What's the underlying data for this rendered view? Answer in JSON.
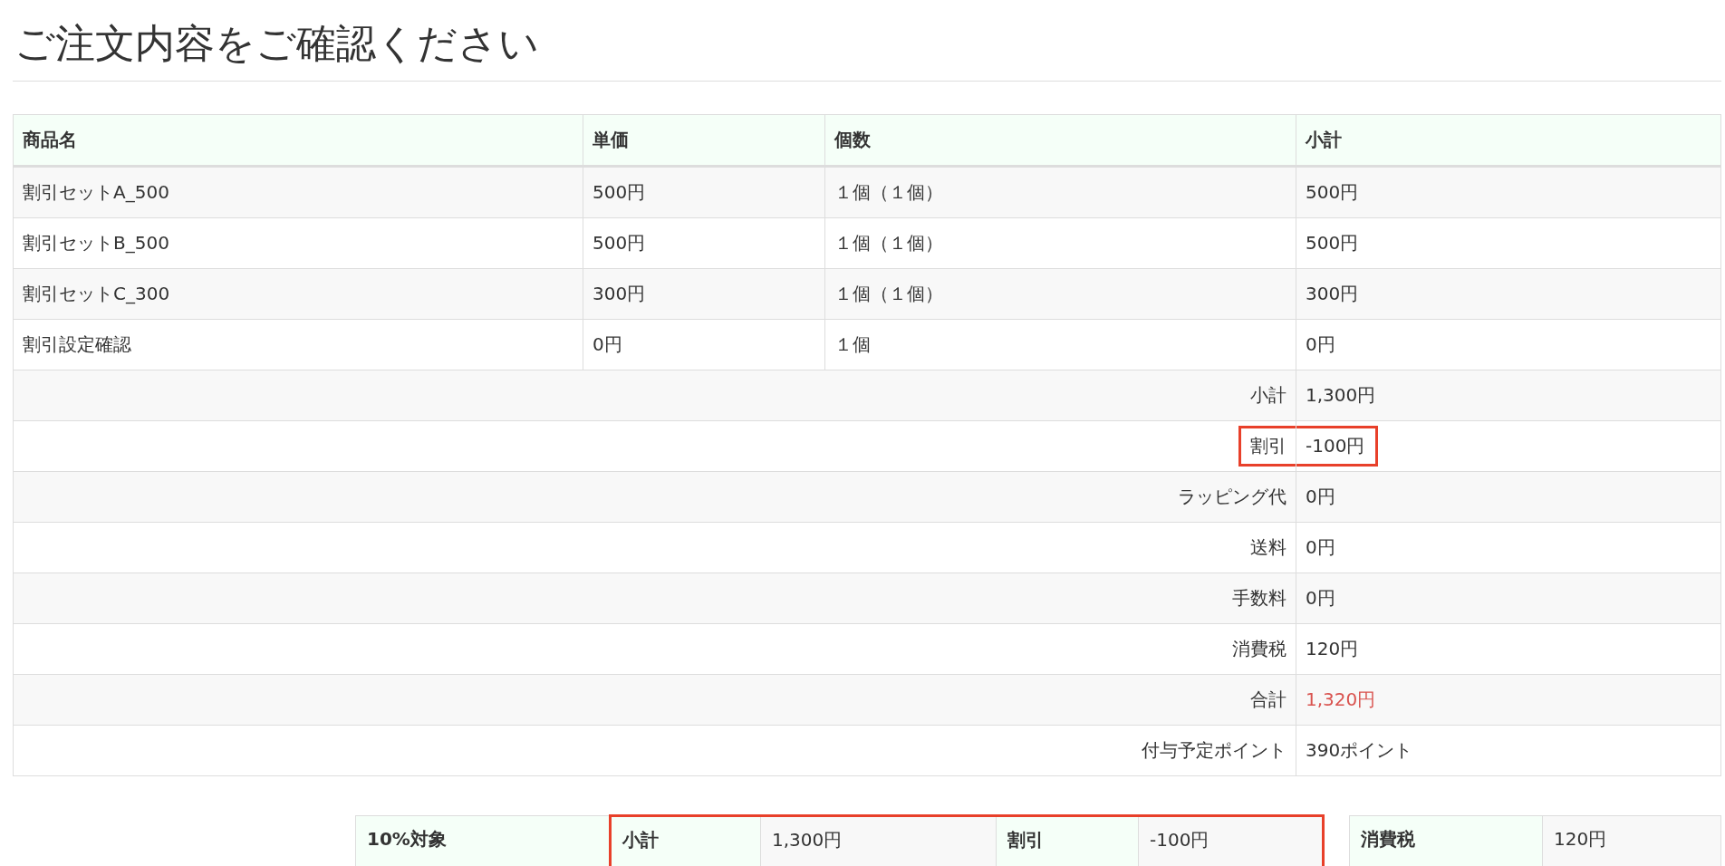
{
  "title": "ご注文内容をご確認ください",
  "order_table": {
    "columns": [
      "商品名",
      "単価",
      "個数",
      "小計"
    ],
    "rows": [
      {
        "name": "割引セットA_500",
        "unit_price": "500円",
        "quantity": "１個（１個）",
        "subtotal": "500円"
      },
      {
        "name": "割引セットB_500",
        "unit_price": "500円",
        "quantity": "１個（１個）",
        "subtotal": "500円"
      },
      {
        "name": "割引セットC_300",
        "unit_price": "300円",
        "quantity": "１個（１個）",
        "subtotal": "300円"
      },
      {
        "name": "割引設定確認",
        "unit_price": "0円",
        "quantity": "１個",
        "subtotal": "0円"
      }
    ],
    "summary": [
      {
        "label": "小計",
        "value": "1,300円",
        "highlighted": false,
        "emphasized": false
      },
      {
        "label": "割引",
        "value": "-100円",
        "highlighted": true,
        "emphasized": false
      },
      {
        "label": "ラッピング代",
        "value": "0円",
        "highlighted": false,
        "emphasized": false
      },
      {
        "label": "送料",
        "value": "0円",
        "highlighted": false,
        "emphasized": false
      },
      {
        "label": "手数料",
        "value": "0円",
        "highlighted": false,
        "emphasized": false
      },
      {
        "label": "消費税",
        "value": "120円",
        "highlighted": false,
        "emphasized": false
      },
      {
        "label": "合計",
        "value": "1,320円",
        "highlighted": false,
        "emphasized": true
      },
      {
        "label": "付与予定ポイント",
        "value": "390ポイント",
        "highlighted": false,
        "emphasized": false
      }
    ]
  },
  "tax_table": {
    "rate_label": "10%対象",
    "subtotal": {
      "label": "小計",
      "value": "1,300円"
    },
    "discount": {
      "label": "割引",
      "value": "-100円"
    },
    "highlighted": true,
    "tax": {
      "label": "消費税",
      "value": "120円"
    }
  }
}
